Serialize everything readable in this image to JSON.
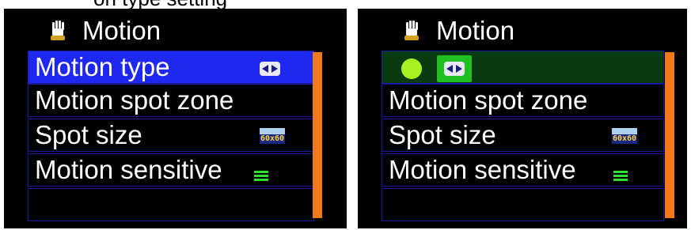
{
  "top_text": "on type setting",
  "menu": {
    "title": "Motion",
    "title_icon": "hand-icon",
    "items": [
      {
        "label": "Motion type",
        "icon": "left-right-arrow-icon"
      },
      {
        "label": "Motion spot zone"
      },
      {
        "label": "Spot size",
        "icon": "spot-size-icon",
        "icon_text": "60x60"
      },
      {
        "label": "Motion sensitive",
        "icon": "sensitivity-bars-icon"
      },
      {
        "label": ""
      }
    ]
  },
  "left_screen": {
    "selected_index": 0,
    "selected_color": "#1f28f0"
  },
  "right_screen": {
    "editing_index": 0,
    "edit_color": "#0a3a10",
    "edit_indicator_color": "#a8f020",
    "edit_box_color": "#20c020"
  },
  "scrollbar_color": "#f07a1a"
}
